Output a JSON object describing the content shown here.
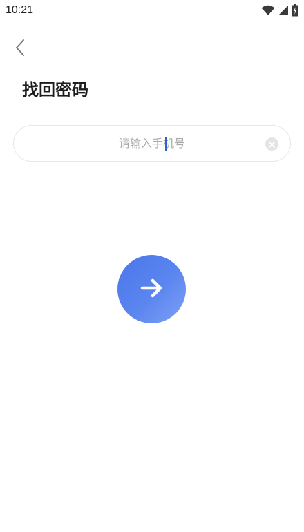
{
  "status_bar": {
    "time": "10:21",
    "icons": [
      "wifi-icon",
      "signal-icon",
      "battery-charging-icon"
    ]
  },
  "header": {
    "back_icon": "chevron-left-icon",
    "title": "找回密码"
  },
  "form": {
    "phone_placeholder": "请输入手机号",
    "phone_value": "",
    "clear_icon": "clear-circle-icon",
    "submit_icon": "arrow-right-icon"
  },
  "colors": {
    "accent_start": "#4a76ea",
    "accent_end": "#7ea0f6",
    "cursor": "#2e63c9"
  }
}
